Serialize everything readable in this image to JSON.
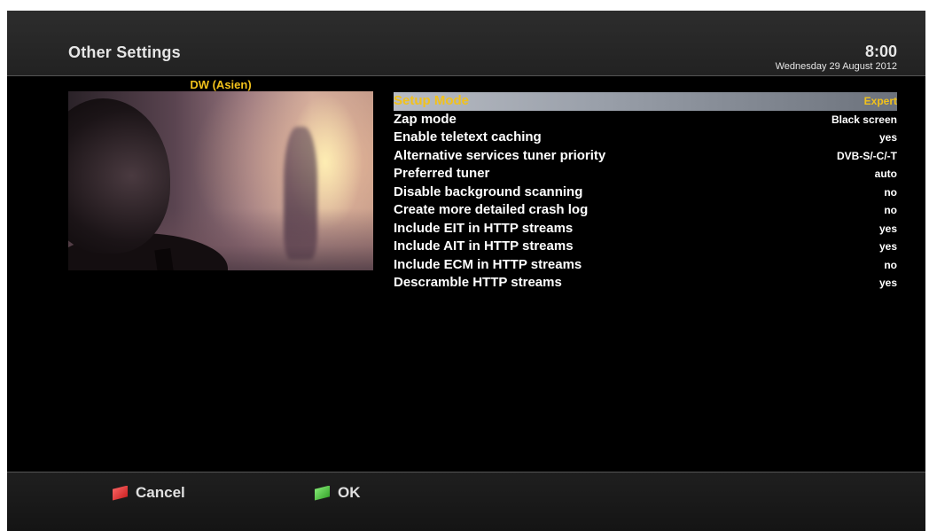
{
  "header": {
    "title": "Other Settings",
    "time": "8:00",
    "date": "Wednesday 29 August 2012"
  },
  "preview": {
    "channel": "DW (Asien)"
  },
  "settings": [
    {
      "label": "Setup Mode",
      "value": "Expert",
      "selected": true
    },
    {
      "label": "Zap mode",
      "value": "Black screen"
    },
    {
      "label": "Enable teletext caching",
      "value": "yes"
    },
    {
      "label": "Alternative services tuner priority",
      "value": "DVB-S/-C/-T"
    },
    {
      "label": "Preferred tuner",
      "value": "auto"
    },
    {
      "label": "Disable background scanning",
      "value": "no"
    },
    {
      "label": "Create more detailed crash log",
      "value": "no"
    },
    {
      "label": "Include EIT in HTTP streams",
      "value": "yes"
    },
    {
      "label": "Include AIT in HTTP streams",
      "value": "yes"
    },
    {
      "label": "Include ECM in HTTP streams",
      "value": "no"
    },
    {
      "label": "Descramble HTTP streams",
      "value": "yes"
    }
  ],
  "footer": {
    "cancel_label": "Cancel",
    "ok_label": "OK"
  },
  "colors": {
    "highlight_text": "#f2c21b",
    "red_key": "#d32020",
    "green_key": "#3cb32c"
  }
}
